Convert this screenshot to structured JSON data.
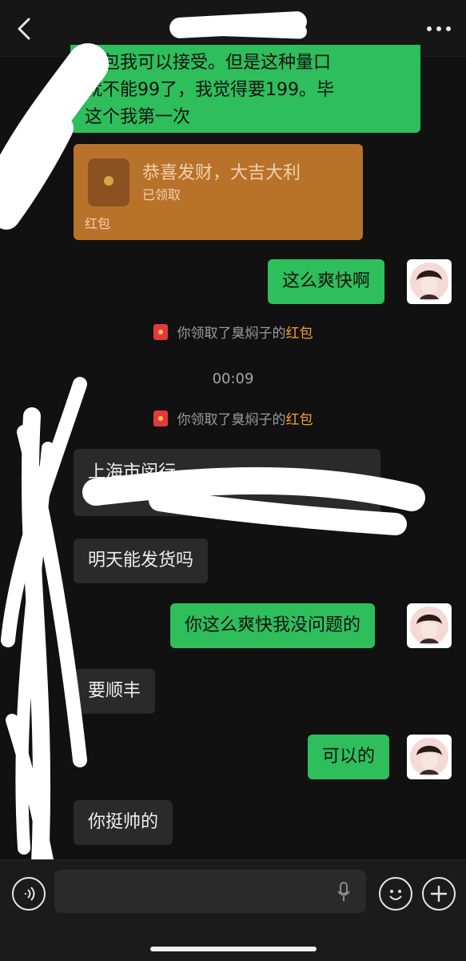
{
  "header": {
    "back_icon": "chevron-left-icon",
    "more_icon": "more-dots-icon"
  },
  "messages": {
    "top": {
      "line1": "红包我可以接受。但是这种量口",
      "line2": "就不能99了，我觉得要199。毕",
      "line3": "这个我第一次"
    },
    "red_packet": {
      "title": "恭喜发财，大吉大利",
      "status": "已领取",
      "label": "红包"
    },
    "msg_zhemeshuang": "这么爽快啊",
    "system1_prefix": "你领取了臭焖子的",
    "system1_hb": "红包",
    "time": "00:09",
    "system2_prefix": "你领取了臭焖子的",
    "system2_hb": "红包",
    "address_partial": "上海市闵行",
    "msg_fahuo": "明天能发货吗",
    "msg_reply1": "你这么爽快我没问题的",
    "msg_shunfeng": "要顺丰",
    "msg_keyi": "可以的",
    "msg_shuai": "你挺帅的"
  },
  "input": {
    "voice_icon": "voice-icon",
    "mic_icon": "mic-icon",
    "emoji_icon": "emoji-icon",
    "plus_icon": "plus-icon"
  },
  "colors": {
    "my_bubble": "#2ebe5c",
    "other_bubble": "#2a2a2a",
    "red_packet": "#b8722a",
    "red_packet_text": "#f1d2b0",
    "system_highlight": "#f59e3a"
  }
}
